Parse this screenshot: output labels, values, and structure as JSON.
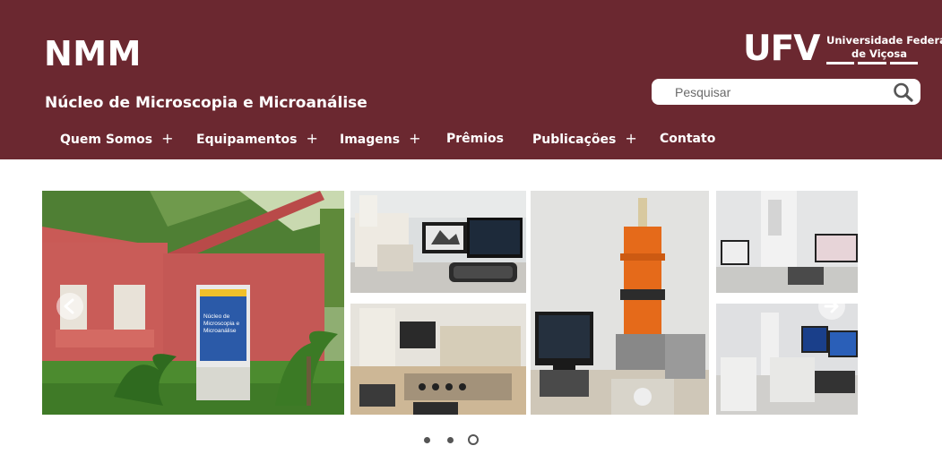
{
  "header": {
    "site_title": "NMM",
    "site_subtitle": "Núcleo de Microscopia e Microanálise",
    "logo": {
      "acronym": "UFV",
      "name_line1": "Universidade Federal",
      "name_line2": "de Viçosa"
    },
    "search": {
      "placeholder": "Pesquisar",
      "icon": "search-icon"
    }
  },
  "nav": {
    "items": [
      {
        "label": "Quem Somos",
        "expand": "+"
      },
      {
        "label": "Equipamentos",
        "expand": "+"
      },
      {
        "label": "Imagens",
        "expand": "+"
      },
      {
        "label": "Prêmios"
      },
      {
        "label": "Publicações",
        "expand": "+"
      },
      {
        "label": "Contato"
      }
    ]
  },
  "carousel": {
    "prev_icon": "arrow-left-icon",
    "next_icon": "arrow-right-icon",
    "slides_count": 3,
    "active_slide": 3,
    "building_sign": {
      "line1": "Núcleo de",
      "line2": "Microscopia e",
      "line3": "Microanálise"
    }
  },
  "colors": {
    "header_bg": "#6b2830",
    "text_on_header": "#ffffff"
  }
}
